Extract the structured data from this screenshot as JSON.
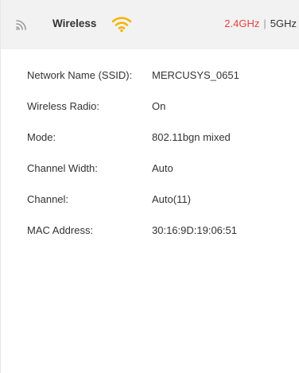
{
  "header": {
    "title": "Wireless",
    "icon": "wireless-signal-icon",
    "status_icon": "wifi-active-icon",
    "status_color": "#f5b400",
    "bands": [
      {
        "label": "2.4GHz",
        "active": true
      },
      {
        "label": "5GHz",
        "active": false
      }
    ],
    "band_separator": "|",
    "active_color": "#e8413e"
  },
  "info": [
    {
      "label": "Network Name (SSID):",
      "value": "MERCUSYS_0651"
    },
    {
      "label": "Wireless Radio:",
      "value": "On"
    },
    {
      "label": "Mode:",
      "value": "802.11bgn mixed"
    },
    {
      "label": "Channel Width:",
      "value": "Auto"
    },
    {
      "label": "Channel:",
      "value": "Auto(11)"
    },
    {
      "label": "MAC Address:",
      "value": "30:16:9D:19:06:51"
    }
  ]
}
